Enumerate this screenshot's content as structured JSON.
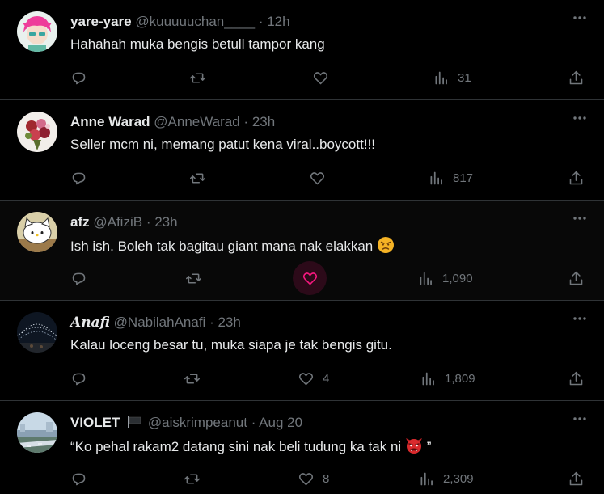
{
  "colors": {
    "background": "#000000",
    "text": "#e7e9ea",
    "muted": "#71767b",
    "like": "#f91880",
    "divider": "#2f3336"
  },
  "tweets": [
    {
      "name": "yare-yare",
      "handle": "@kuuuuuchan____",
      "time": "12h",
      "text": "Hahahah muka bengis betull tampor kang",
      "replies": "",
      "retweets": "",
      "likes": "",
      "views": "31",
      "liked": false,
      "avatar_icon": "pink-hair-anime-avatar"
    },
    {
      "name": "Anne Warad",
      "handle": "@AnneWarad",
      "time": "23h",
      "text": "Seller mcm ni, memang patut kena viral..boycott!!!",
      "replies": "",
      "retweets": "",
      "likes": "",
      "views": "817",
      "liked": false,
      "avatar_icon": "flower-bouquet-avatar"
    },
    {
      "name": "afz",
      "handle": "@AfiziB",
      "time": "23h",
      "text": "Ish ish. Boleh tak bagitau giant mana nak elakkan",
      "emoji": "angry-face-emoji",
      "replies": "",
      "retweets": "",
      "likes": "",
      "views": "1,090",
      "liked": true,
      "avatar_icon": "hello-kitty-avatar"
    },
    {
      "name": "Anafi",
      "handle": "@NabilahAnafi",
      "time": "23h",
      "text": "Kalau loceng besar tu, muka siapa je tak bengis gitu.",
      "replies": "",
      "retweets": "",
      "likes": "4",
      "views": "1,809",
      "liked": false,
      "avatar_icon": "night-lights-avatar"
    },
    {
      "name": "VIOLET",
      "handle": "@aiskrimpeanut",
      "time": "Aug 20",
      "text": "“Ko pehal rakam2 datang sini nak beli tudung ka tak ni",
      "text_end": "”",
      "emoji": "goblin-mask-emoji",
      "flag_icon": "black-flag-icon",
      "replies": "",
      "retweets": "",
      "likes": "8",
      "views": "2,309",
      "liked": false,
      "avatar_icon": "city-landscape-avatar"
    }
  ]
}
